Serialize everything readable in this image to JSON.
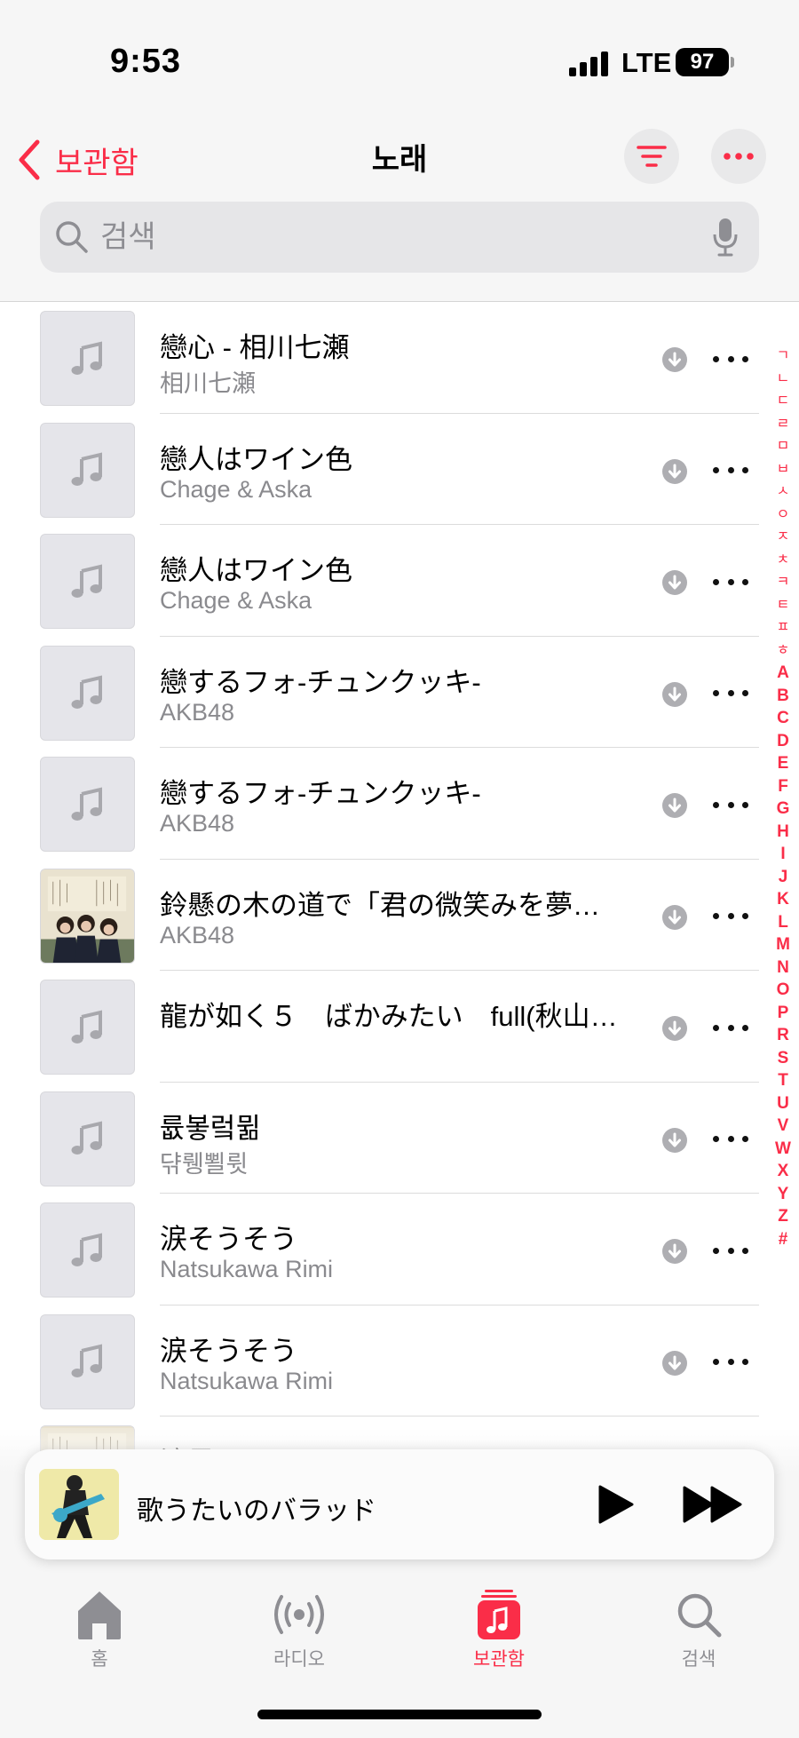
{
  "status_bar": {
    "time": "9:53",
    "network": "LTE",
    "battery": "97"
  },
  "header": {
    "back_label": "보관함",
    "title": "노래"
  },
  "search": {
    "placeholder": "검색"
  },
  "songs": [
    {
      "title": "戀心 - 相川七瀬",
      "artist": "相川七瀬",
      "artwork": "placeholder"
    },
    {
      "title": "戀人はワイン色",
      "artist": "Chage & Aska",
      "artwork": "placeholder"
    },
    {
      "title": "戀人はワイン色",
      "artist": "Chage & Aska",
      "artwork": "placeholder"
    },
    {
      "title": "戀するフォ-チュンクッキ-",
      "artist": "AKB48",
      "artwork": "placeholder"
    },
    {
      "title": "戀するフォ-チュンクッキ-",
      "artist": "AKB48",
      "artwork": "placeholder"
    },
    {
      "title": "鈴懸の木の道で「君の微笑みを夢に…",
      "artist": "AKB48",
      "artwork": "photo"
    },
    {
      "title": "龍が如く５　ばかみたい　full(秋山…",
      "artist": "",
      "artwork": "placeholder"
    },
    {
      "title": "륪봏렄뮒",
      "artist": "댞뤵뾜륏",
      "artwork": "placeholder"
    },
    {
      "title": "涙そうそう",
      "artist": "Natsukawa Rimi",
      "artwork": "placeholder"
    },
    {
      "title": "涙そうそう",
      "artist": "Natsukawa Rimi",
      "artwork": "placeholder"
    },
    {
      "title": "涙星",
      "artist": "",
      "artwork": "photo"
    }
  ],
  "index_letters": [
    "ㄱ",
    "ㄴ",
    "ㄷ",
    "ㄹ",
    "ㅁ",
    "ㅂ",
    "ㅅ",
    "ㅇ",
    "ㅈ",
    "ㅊ",
    "ㅋ",
    "ㅌ",
    "ㅍ",
    "ㅎ",
    "A",
    "B",
    "C",
    "D",
    "E",
    "F",
    "G",
    "H",
    "I",
    "J",
    "K",
    "L",
    "M",
    "N",
    "O",
    "P",
    "R",
    "S",
    "T",
    "U",
    "V",
    "W",
    "X",
    "Y",
    "Z",
    "#"
  ],
  "now_playing": {
    "title": "歌うたいのバラッド"
  },
  "tabs": [
    {
      "label": "홈",
      "icon": "home-icon",
      "active": false
    },
    {
      "label": "라디오",
      "icon": "radio-icon",
      "active": false
    },
    {
      "label": "보관함",
      "icon": "library-icon",
      "active": true
    },
    {
      "label": "검색",
      "icon": "search-icon",
      "active": false
    }
  ],
  "colors": {
    "accent": "#fa2d48",
    "secondary_text": "#8a8a8e",
    "background": "#f6f6f6"
  }
}
